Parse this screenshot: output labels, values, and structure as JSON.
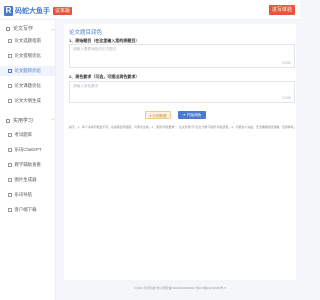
{
  "header": {
    "logo_mark": "R",
    "app_name": "码蛇大鱼手",
    "version_badge": "议本版",
    "top_button": "进写体验"
  },
  "sidebar": {
    "group1": {
      "label": "论文写作",
      "icon": "pen-icon",
      "chevron": "︿"
    },
    "items_group1": [
      {
        "label": "论文选题指南"
      },
      {
        "label": "论文提纲优化"
      },
      {
        "label": "论文题目优化"
      },
      {
        "label": "论文课题优化"
      },
      {
        "label": "论文大纲生成"
      }
    ],
    "group2": {
      "label": "实用学习",
      "icon": "book-icon",
      "chevron": "﹀"
    },
    "items_group2": [
      {
        "label": "考试题库"
      },
      {
        "label": "乐讯ChatGPT"
      },
      {
        "label": "教学辅助查看"
      },
      {
        "label": "图片生成器"
      },
      {
        "label": "乐讯导航"
      },
      {
        "label": "客户端下载"
      }
    ]
  },
  "main": {
    "title": "论文题目润色",
    "section1_label": "1、原始题目（在这里输入您的原题目）",
    "section1_placeholder": "请输入需要润色的论文题目",
    "section1_counter": "0/150",
    "section2_label": "2、润色要求（可选，可提出润色要求）",
    "section2_placeholder": "请输入润色要求",
    "section2_counter": "0/150",
    "example_button": "♦ 示例数据",
    "generate_button": "✦ 开始润色",
    "tips": "提示：1、每个请求可能会不同，在提醒您何使用，可再次生成。2、使用“润色要求”，“论文标题”与“论文大纲”可提升润色质量。3、可能在少先由，无法确保题目准确，仅供参考。"
  },
  "footer": {
    "text": "©2023 乐讯科技  浙公网安备33010602009000  浙ICP备13044563号-5"
  },
  "colors": {
    "accent": "#4a7bd0",
    "badge": "#e9553b"
  }
}
